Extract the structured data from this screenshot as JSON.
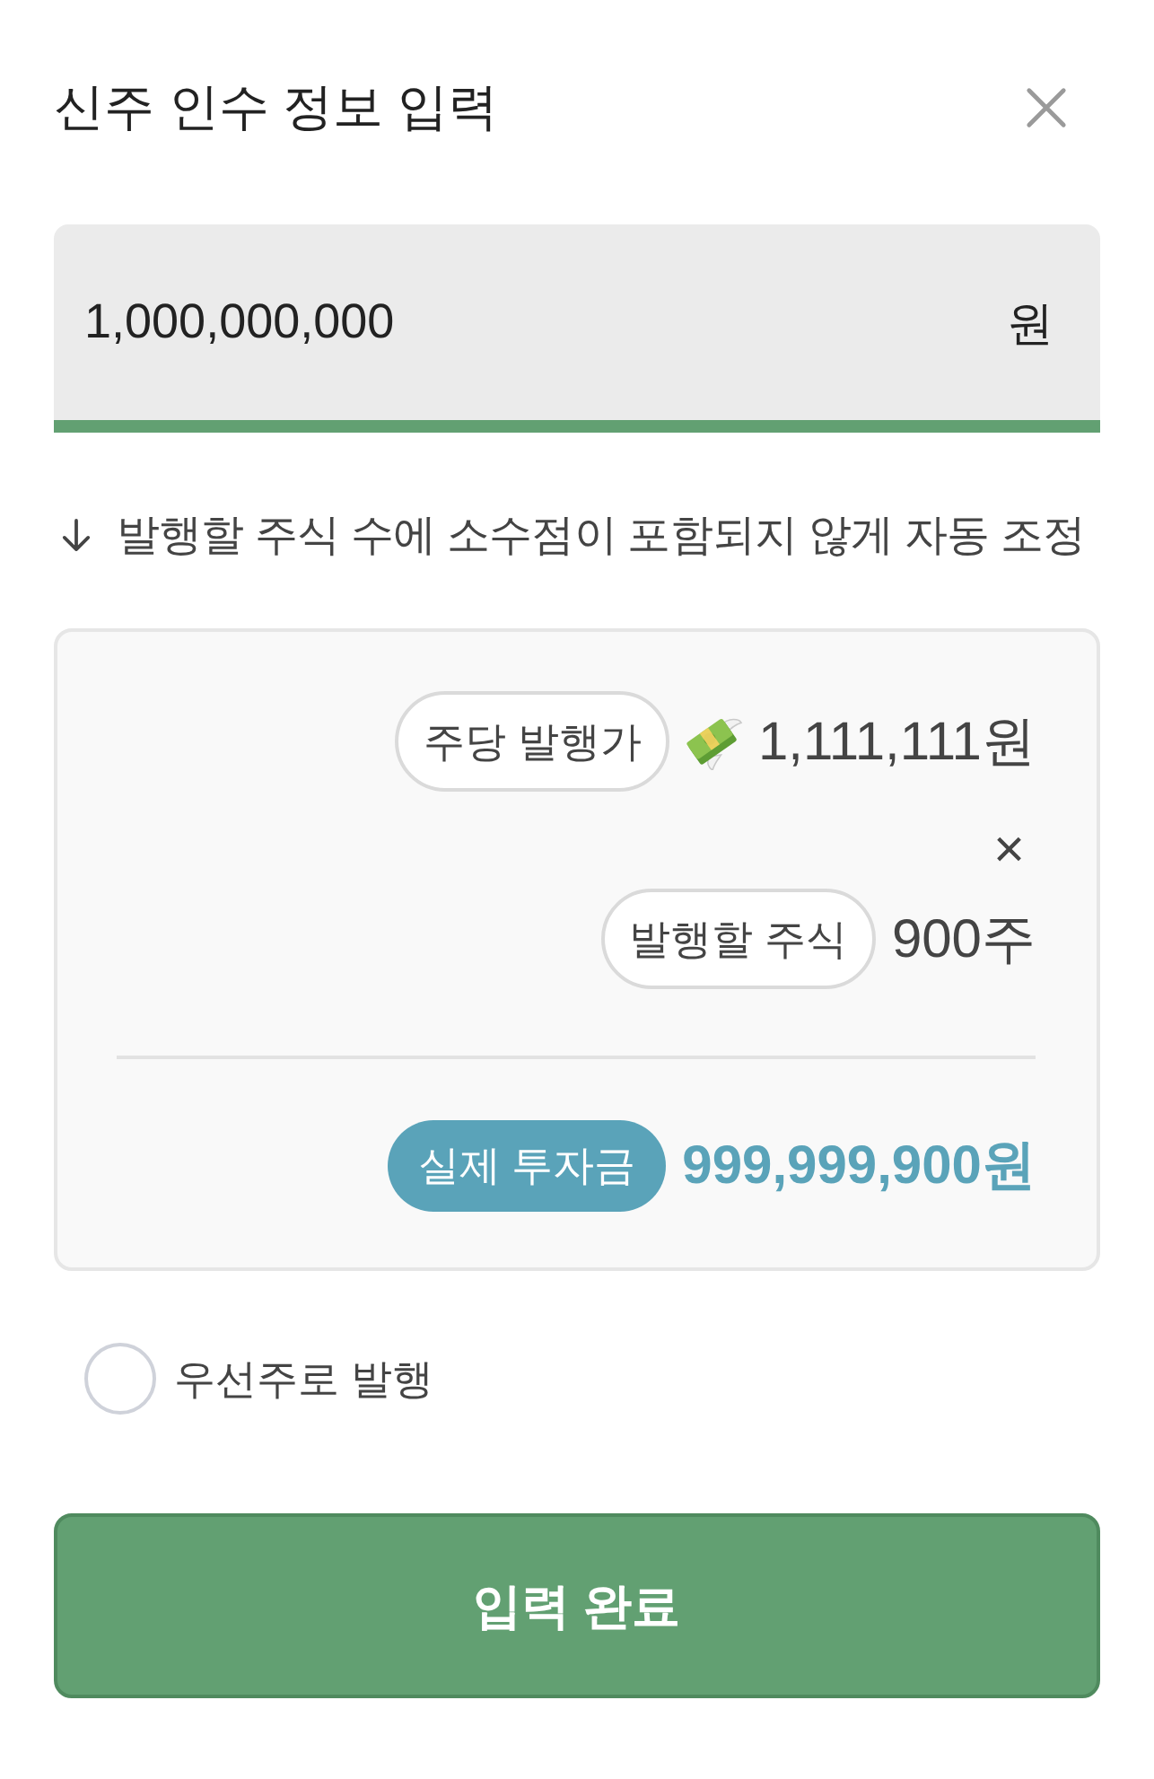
{
  "dialog": {
    "title": "신주 인수 정보 입력"
  },
  "amount_field": {
    "value": "1,000,000,000",
    "unit": "원"
  },
  "hint": "발행할 주식 수에 소수점이 포함되지 않게 자동 조정",
  "calculation": {
    "price": {
      "label": "주당 발행가",
      "value": "1,111,111원"
    },
    "operator": "×",
    "shares": {
      "label": "발행할 주식",
      "value": "900주"
    },
    "total": {
      "label": "실제 투자금",
      "value": "999,999,900원"
    }
  },
  "preferred_stock": {
    "label": "우선주로 발행",
    "checked": false
  },
  "submit_button": {
    "label": "입력 완료"
  }
}
